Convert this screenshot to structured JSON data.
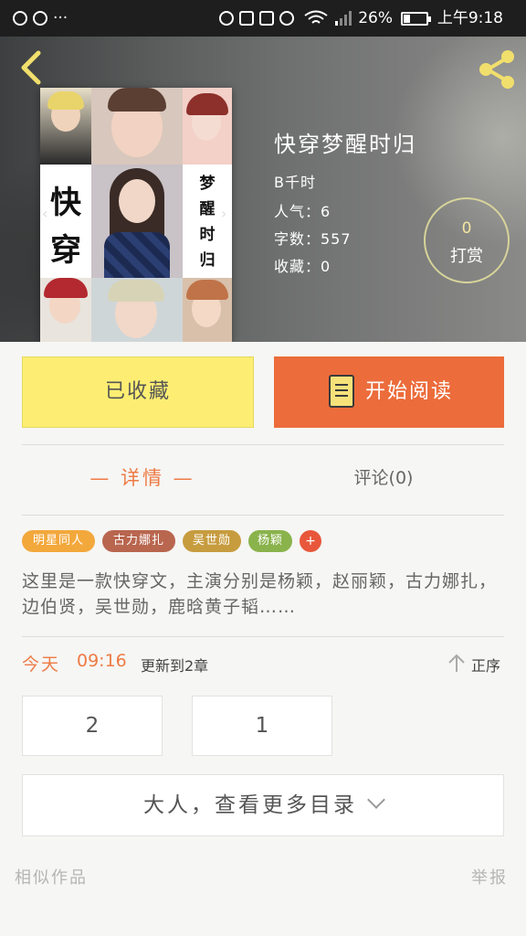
{
  "status_bar": {
    "icons": [
      "alarm-icon",
      "record-icon",
      "more-dots-icon",
      "vibrate-icon",
      "nfc-icon",
      "mute-icon",
      "alarm-icon",
      "wifi-icon",
      "signal-icon",
      "battery-icon"
    ],
    "dots": "···",
    "battery_percent": "26%",
    "time": "上午9:18"
  },
  "header": {
    "book_title": "快穿梦醒时归",
    "author": "B千时",
    "popularity": "人气：6",
    "word_count": "字数：557",
    "favorites": "收藏：0",
    "tip_count": "0",
    "tip_label": "打赏"
  },
  "cover": {
    "title_left": [
      "快",
      "穿"
    ],
    "title_right": [
      "梦",
      "醒",
      "时",
      "归"
    ]
  },
  "actions": {
    "collected_label": "已收藏",
    "read_label": "开始阅读"
  },
  "tabs": {
    "detail": "— 详情 —",
    "comments": "评论(0)"
  },
  "tags": [
    {
      "label": "明星同人",
      "color": "#f3a83c"
    },
    {
      "label": "古力娜扎",
      "color": "#b9664f"
    },
    {
      "label": "吴世勋",
      "color": "#c79c3f"
    },
    {
      "label": "杨颖",
      "color": "#8ab34c"
    }
  ],
  "tag_add": "+",
  "description": "这里是一款快穿文，主演分别是杨颖，赵丽颖，古力娜扎，边伯贤，吴世勋，鹿晗黄子韬……",
  "update": {
    "day": "今天",
    "time": "09:16",
    "text": "更新到2章",
    "sort_label": "正序"
  },
  "chapters": [
    "2",
    "1"
  ],
  "more_catalog": "大人，查看更多目录",
  "footer": {
    "similar_works": "相似作品",
    "report": "举报"
  },
  "colors": {
    "accent": "#ec6c3b",
    "collected": "#fdee73",
    "tab_active": "#ee7b45"
  }
}
